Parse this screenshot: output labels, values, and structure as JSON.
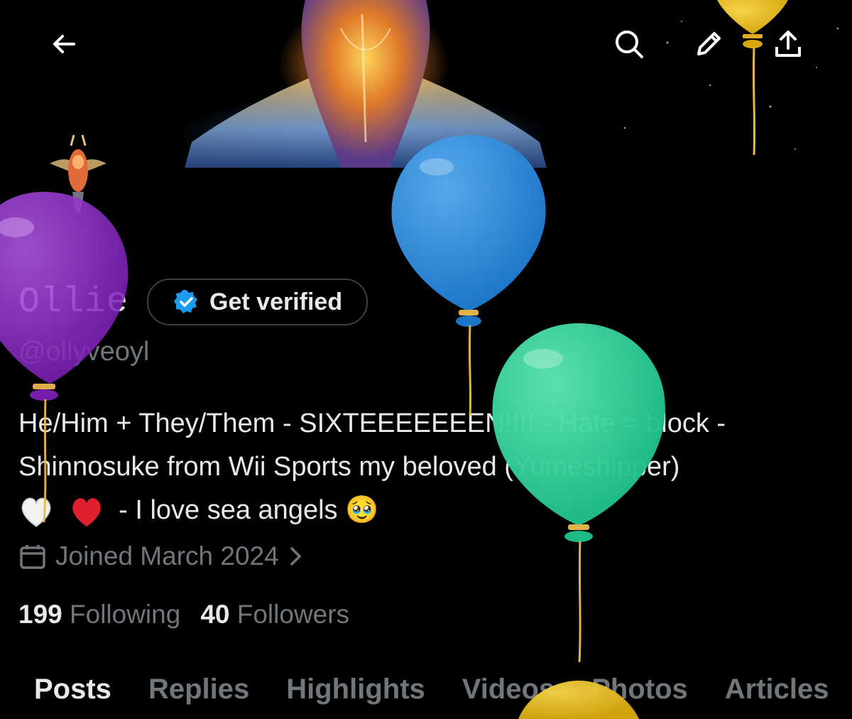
{
  "header": {
    "back_icon": "arrow-left-icon",
    "search_icon": "search-icon",
    "edit_icon": "pencil-icon",
    "share_icon": "share-icon"
  },
  "profile": {
    "display_name": "Ollie",
    "get_verified_label": "Get verified",
    "handle": "@ollyveoyl",
    "bio_line1": "He/Him + They/Them - SIXTEEEEEEEN!!!! - Hate = block -",
    "bio_line2": "Shinnosuke from Wii Sports my beloved (Yumeshipper)",
    "bio_line3": "- I love sea angels",
    "bio_emoji_end": "🥹",
    "joined": "Joined March 2024",
    "following_count": "199",
    "following_label": "Following",
    "followers_count": "40",
    "followers_label": "Followers"
  },
  "tabs": [
    {
      "label": "Posts",
      "active": true
    },
    {
      "label": "Replies",
      "active": false
    },
    {
      "label": "Highlights",
      "active": false
    },
    {
      "label": "Videos",
      "active": false
    },
    {
      "label": "Photos",
      "active": false
    },
    {
      "label": "Articles",
      "active": false
    }
  ],
  "colors": {
    "background": "#000000",
    "text_primary": "#e7e9ea",
    "text_secondary": "#71767b",
    "verified_blue": "#1d9bf0",
    "balloon_purple": "#9b30d0",
    "balloon_blue": "#2f8fe0",
    "balloon_green": "#2fd39a",
    "balloon_yellow": "#e6b820"
  }
}
